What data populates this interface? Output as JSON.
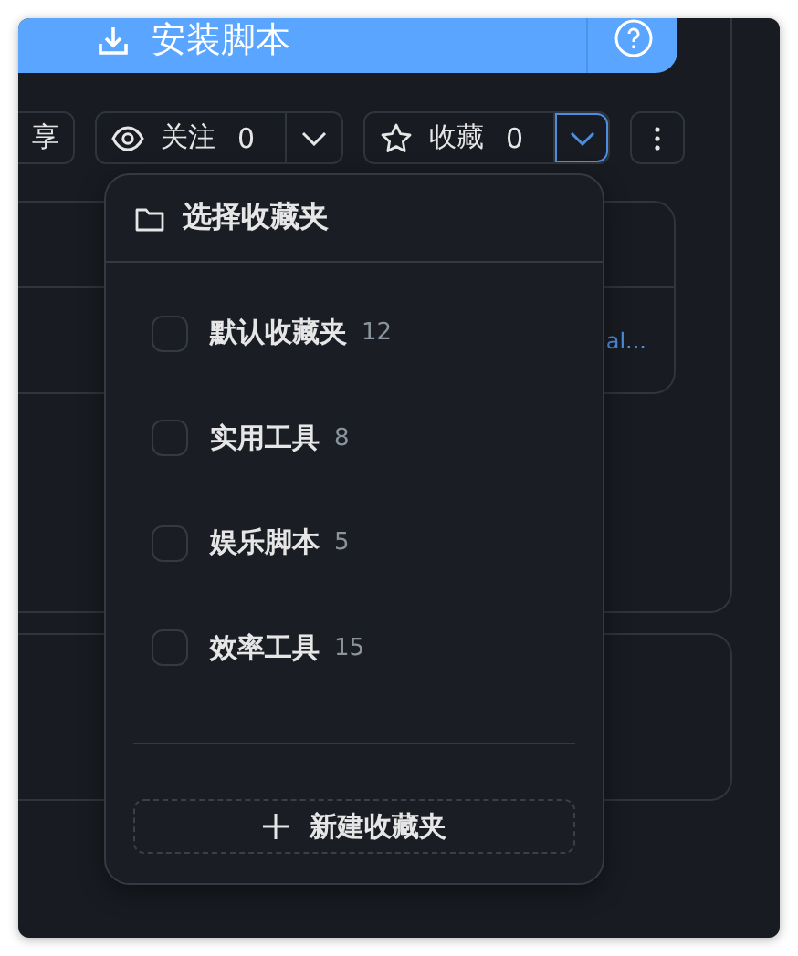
{
  "install_button": {
    "label": "安装脚本"
  },
  "toolbar": {
    "share_button": {
      "label": "享"
    },
    "watch": {
      "label": "关注",
      "count": "0",
      "expanded": false
    },
    "favorite": {
      "label": "收藏",
      "count": "0",
      "expanded": true
    }
  },
  "card_link": "al...",
  "dropdown": {
    "title": "选择收藏夹",
    "folders": [
      {
        "name": "默认收藏夹",
        "count": "12",
        "checked": false
      },
      {
        "name": "实用工具",
        "count": "8",
        "checked": false
      },
      {
        "name": "娱乐脚本",
        "count": "5",
        "checked": false
      },
      {
        "name": "效率工具",
        "count": "15",
        "checked": false
      }
    ],
    "new_folder_button": "新建收藏夹"
  }
}
